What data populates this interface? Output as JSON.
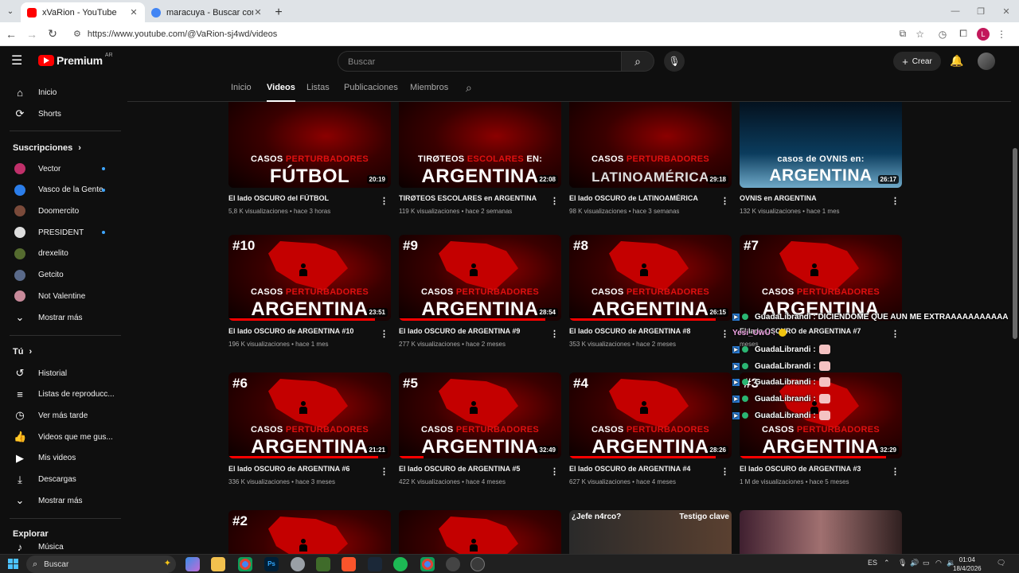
{
  "browser": {
    "tabs": [
      {
        "title": "xVaRion - YouTube",
        "active": true,
        "favicon_color": "#ff0000"
      },
      {
        "title": "maracuya - Buscar con Google",
        "active": false,
        "favicon_color": "#4285f4"
      }
    ],
    "url": "https://www.youtube.com/@VaRion-sj4wd/videos",
    "profile_letter": "L"
  },
  "youtube": {
    "logo_text": "Premium",
    "country_code": "AR",
    "search_placeholder": "Buscar",
    "create_label": "Crear"
  },
  "sidebar": {
    "main": [
      {
        "label": "Inicio",
        "icon": "home-icon"
      },
      {
        "label": "Shorts",
        "icon": "shorts-icon"
      }
    ],
    "subscriptions_header": "Suscripciones",
    "subscriptions": [
      {
        "label": "Vector",
        "new": true,
        "color": "#c0306a"
      },
      {
        "label": "Vasco de la Gente",
        "new": true,
        "color": "#2b7de9"
      },
      {
        "label": "Doomercito",
        "new": false,
        "color": "#7a4a3a"
      },
      {
        "label": "PRESIDENT",
        "new": true,
        "color": "#dddddd"
      },
      {
        "label": "drexelito",
        "new": false,
        "color": "#556b2f"
      },
      {
        "label": "Getcito",
        "new": false,
        "color": "#5a6a8a"
      },
      {
        "label": "Not Valentine",
        "new": false,
        "color": "#c88a9a"
      }
    ],
    "subscriptions_more": "Mostrar más",
    "you_header": "Tú",
    "you": [
      {
        "label": "Historial",
        "icon": "history-icon"
      },
      {
        "label": "Listas de reproducc...",
        "icon": "playlists-icon"
      },
      {
        "label": "Ver más tarde",
        "icon": "watch-later-icon"
      },
      {
        "label": "Videos que me gus...",
        "icon": "like-icon"
      },
      {
        "label": "Mis videos",
        "icon": "my-videos-icon"
      },
      {
        "label": "Descargas",
        "icon": "downloads-icon"
      }
    ],
    "you_more": "Mostrar más",
    "explore_header": "Explorar",
    "explore_partial": "Música"
  },
  "channel_tabs": [
    "Inicio",
    "Videos",
    "Listas",
    "Publicaciones",
    "Miembros"
  ],
  "selected_tab": "Videos",
  "videos": [
    {
      "title": "El lado OSCURO del FÚTBOL",
      "meta": "5,8 K visualizaciones • hace 3 horas",
      "duration": "20:19",
      "top": "CASOS",
      "top_red": "PERTURBADORES",
      "big": "FÚTBOL",
      "progress": 0
    },
    {
      "title": "TIRØTEOS ESCOLARES en ARGENTINA",
      "meta": "119 K visualizaciones • hace 2 semanas",
      "duration": "22:08",
      "top": "TIRØTEOS",
      "top_red": "ESCOLARES",
      "top_after": "EN:",
      "big": "ARGENTINA",
      "progress": 0
    },
    {
      "title": "El lado OSCURO de LATINOAMÉRICA",
      "meta": "98 K visualizaciones • hace 3 semanas",
      "duration": "29:18",
      "top": "CASOS",
      "top_red": "PERTURBADORES",
      "big": "LATINOAMÉRICA",
      "progress": 0
    },
    {
      "title": "OVNIS en ARGENTINA",
      "meta": "132 K visualizaciones • hace 1 mes",
      "duration": "26:17",
      "top": "casos de OVNIS en:",
      "top_red": "",
      "big": "ARGENTINA",
      "progress": 0
    },
    {
      "title": "El lado OSCURO de ARGENTINA #10",
      "meta": "196 K visualizaciones • hace 1 mes",
      "duration": "23:51",
      "num": "#10",
      "top": "CASOS",
      "top_red": "PERTURBADORES",
      "big": "ARGENTINA",
      "progress": 0.9
    },
    {
      "title": "El lado OSCURO de ARGENTINA #9",
      "meta": "277 K visualizaciones • hace 2 meses",
      "duration": "28:54",
      "num": "#9",
      "top": "CASOS",
      "top_red": "PERTURBADORES",
      "big": "ARGENTINA",
      "progress": 0.9
    },
    {
      "title": "El lado OSCURO de ARGENTINA #8",
      "meta": "353 K visualizaciones • hace 2 meses",
      "duration": "26:15",
      "num": "#8",
      "top": "CASOS",
      "top_red": "PERTURBADORES",
      "big": "ARGENTINA",
      "progress": 0.9
    },
    {
      "title": "El lado OSCURO de ARGENTINA #7",
      "meta": "meses",
      "duration": "",
      "num": "#7",
      "top": "CASOS",
      "top_red": "PERTURBADORES",
      "big": "ARGENTINA",
      "progress": 0
    },
    {
      "title": "El lado OSCURO de ARGENTINA #6",
      "meta": "336 K visualizaciones • hace 3 meses",
      "duration": "21:21",
      "num": "#6",
      "top": "CASOS",
      "top_red": "PERTURBADORES",
      "big": "ARGENTINA",
      "progress": 0.92
    },
    {
      "title": "El lado OSCURO de ARGENTINA #5",
      "meta": "422 K visualizaciones • hace 4 meses",
      "duration": "32:49",
      "num": "#5",
      "top": "CASOS",
      "top_red": "PERTURBADORES",
      "big": "ARGENTINA",
      "progress": 0.15
    },
    {
      "title": "El lado OSCURO de ARGENTINA #4",
      "meta": "627 K visualizaciones • hace 4 meses",
      "duration": "28:26",
      "num": "#4",
      "top": "CASOS",
      "top_red": "PERTURBADORES",
      "big": "ARGENTINA",
      "progress": 0.9
    },
    {
      "title": "El lado OSCURO de ARGENTINA #3",
      "meta": "1 M de visualizaciones • hace 5 meses",
      "duration": "32:29",
      "num": "#3",
      "top": "CASOS",
      "top_red": "PERTURBADORES",
      "big": "ARGENTINA",
      "progress": 0.9
    },
    {
      "num": "#2",
      "big": ""
    },
    {
      "big": ""
    },
    {
      "tag_left": "¿Jefe n4rco?",
      "tag_right": "Testigo clave"
    },
    {}
  ],
  "chat": [
    {
      "text": "GuadaLibrandi : DICIENDOME QUE AUN ME EXTRAAAAAAAAAAA"
    },
    {
      "text": "Yesi_UwU :",
      "style": "pink"
    },
    {
      "text": "GuadaLibrandi :"
    },
    {
      "text": "GuadaLibrandi :"
    },
    {
      "text": "GuadaLibrandi :"
    },
    {
      "text": "GuadaLibrandi :"
    },
    {
      "text": "GuadaLibrandi :"
    }
  ],
  "taskbar": {
    "search_label": "Buscar",
    "lang": "ES",
    "time": "01:04",
    "date": "18/4/2026"
  }
}
